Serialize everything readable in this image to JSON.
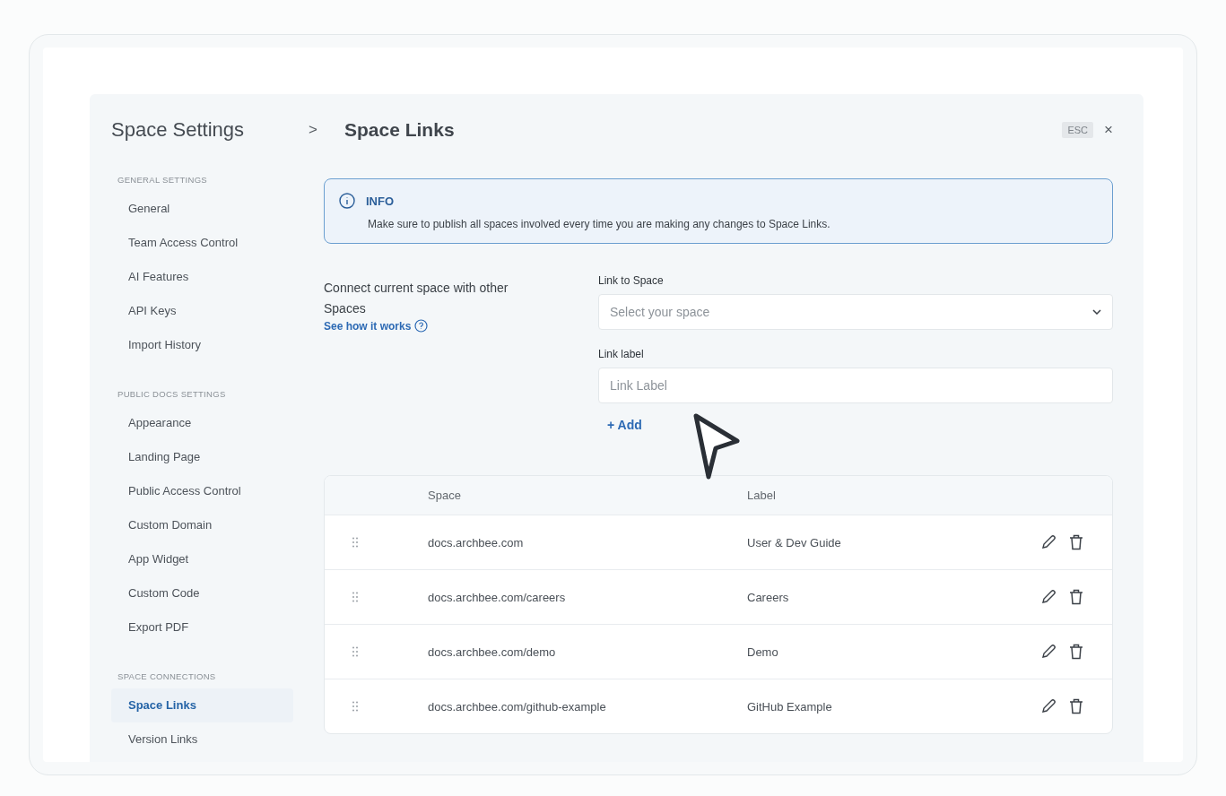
{
  "sidebar": {
    "title": "Space Settings",
    "sections": [
      {
        "heading": "GENERAL SETTINGS",
        "items": [
          {
            "label": "General",
            "selected": false
          },
          {
            "label": "Team Access Control",
            "selected": false
          },
          {
            "label": "AI Features",
            "selected": false
          },
          {
            "label": "API Keys",
            "selected": false
          },
          {
            "label": "Import History",
            "selected": false
          }
        ]
      },
      {
        "heading": "PUBLIC DOCS SETTINGS",
        "items": [
          {
            "label": "Appearance",
            "selected": false
          },
          {
            "label": "Landing Page",
            "selected": false
          },
          {
            "label": "Public Access Control",
            "selected": false
          },
          {
            "label": "Custom Domain",
            "selected": false
          },
          {
            "label": "App Widget",
            "selected": false
          },
          {
            "label": "Custom Code",
            "selected": false
          },
          {
            "label": "Export PDF",
            "selected": false
          }
        ]
      },
      {
        "heading": "SPACE CONNECTIONS",
        "items": [
          {
            "label": "Space Links",
            "selected": true
          },
          {
            "label": "Version Links",
            "selected": false
          }
        ]
      }
    ]
  },
  "breadcrumb_separator": ">",
  "page_title": "Space Links",
  "esc_key": "ESC",
  "close": "×",
  "info": {
    "title": "INFO",
    "message": "Make sure to publish all spaces involved every time you are making any changes to Space Links."
  },
  "connect": {
    "description": "Connect current space with other Spaces",
    "help_link": "See how it works"
  },
  "link_to_space": {
    "label": "Link to Space",
    "placeholder": "Select your space"
  },
  "link_label": {
    "label": "Link label",
    "placeholder": "Link Label"
  },
  "add_button": "+ Add",
  "table": {
    "columns": [
      "Space",
      "Label"
    ],
    "rows": [
      {
        "space": "docs.archbee.com",
        "label": "User & Dev Guide"
      },
      {
        "space": "docs.archbee.com/careers",
        "label": "Careers"
      },
      {
        "space": "docs.archbee.com/demo",
        "label": "Demo"
      },
      {
        "space": "docs.archbee.com/github-example",
        "label": "GitHub Example"
      }
    ]
  }
}
